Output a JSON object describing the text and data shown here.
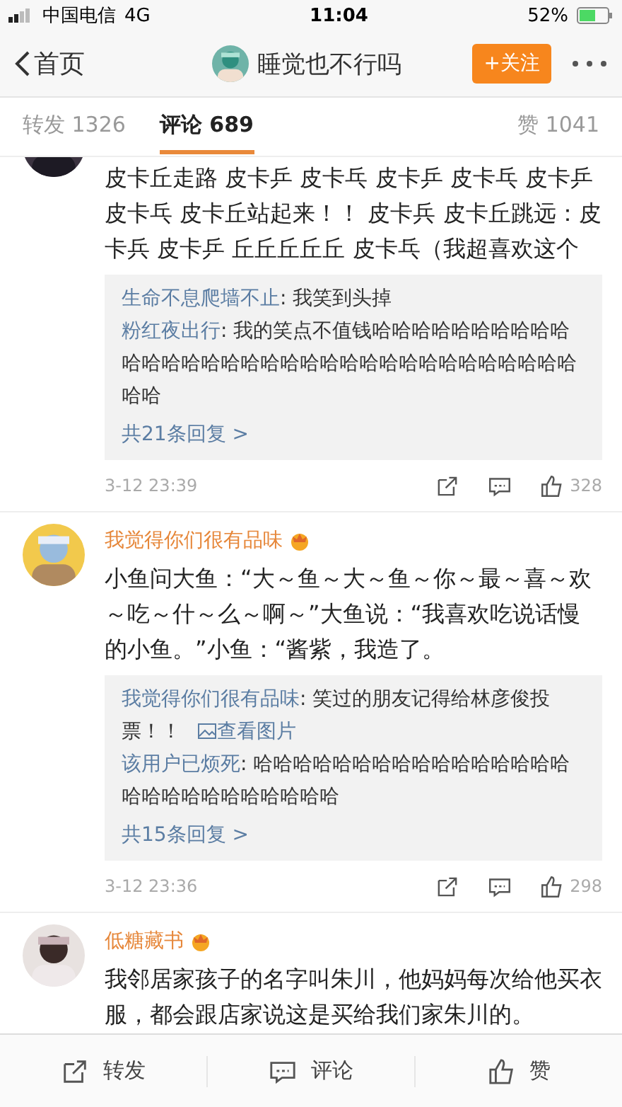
{
  "status_bar": {
    "carrier": "中国电信",
    "network": "4G",
    "time": "11:04",
    "battery": "52%"
  },
  "nav": {
    "back": "首页",
    "title": "睡觉也不行吗",
    "follow": "+关注"
  },
  "tabs": [
    {
      "label": "转发 1326",
      "selected": false
    },
    {
      "label": "评论 689",
      "selected": true
    },
    {
      "label": "赞 1041",
      "selected": false
    }
  ],
  "comments": [
    {
      "body": "皮卡丘走路 皮卡乒 皮卡乓 皮卡乒 皮卡乓 皮卡乒皮卡乓 皮卡丘站起来！！ 皮卡兵 皮卡丘跳远：皮卡兵 皮卡乒 丘丘丘丘丘 皮卡乓（我超喜欢这个",
      "replies": [
        {
          "author": "生命不息爬墙不止",
          "text": ": 我笑到头掉"
        },
        {
          "author": "粉红夜出行",
          "text": ": 我的笑点不值钱哈哈哈哈哈哈哈哈哈哈哈哈哈哈哈哈哈哈哈哈哈哈哈哈哈哈哈哈哈哈哈哈哈哈哈"
        }
      ],
      "more": "共21条回复 >",
      "time": "3-12 23:39",
      "likes": "328"
    },
    {
      "name": "我觉得你们很有品味",
      "body": "小鱼问大鱼：“大～鱼～大～鱼～你～最～喜～欢～吃～什～么～啊～”大鱼说：“我喜欢吃说话慢的小鱼。”小鱼：“酱紫，我造了。",
      "replies": [
        {
          "author": "我觉得你们很有品味",
          "text": ": 笑过的朋友记得给林彦俊投票！！ ",
          "link": "查看图片"
        },
        {
          "author": "该用户已烦死",
          "text": ": 哈哈哈哈哈哈哈哈哈哈哈哈哈哈哈哈哈哈哈哈哈哈哈哈哈哈哈"
        }
      ],
      "more": "共15条回复 >",
      "time": "3-12 23:36",
      "likes": "298"
    },
    {
      "name": "低糖藏书",
      "body": "我邻居家孩子的名字叫朱川，他妈妈每次给他买衣服，都会跟店家说这是买给我们家朱川的。"
    }
  ],
  "bottom_bar": [
    {
      "kind": "share",
      "label": "转发"
    },
    {
      "kind": "comment",
      "label": "评论"
    },
    {
      "kind": "like",
      "label": "赞"
    }
  ]
}
